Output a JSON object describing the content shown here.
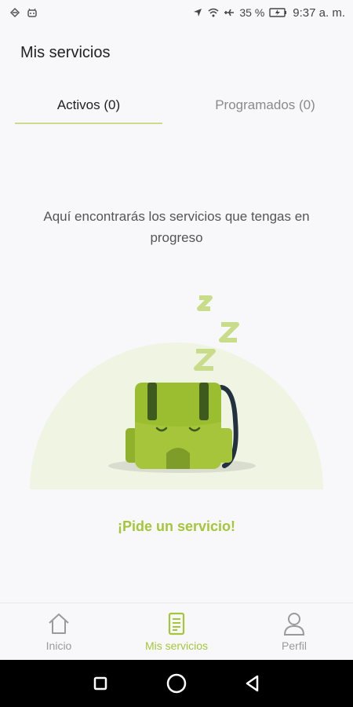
{
  "status_bar": {
    "battery": "35 %",
    "time": "9:37 a. m."
  },
  "page": {
    "title": "Mis servicios"
  },
  "tabs": [
    {
      "label": "Activos (0)",
      "active": true
    },
    {
      "label": "Programados (0)",
      "active": false
    }
  ],
  "empty_state": {
    "message": "Aquí encontrarás los servicios que tengas en progreso",
    "cta_label": "¡Pide un servicio!"
  },
  "bottom_nav": {
    "items": [
      {
        "label": "Inicio",
        "icon": "home-icon",
        "active": false
      },
      {
        "label": "Mis servicios",
        "icon": "document-list-icon",
        "active": true
      },
      {
        "label": "Perfil",
        "icon": "user-icon",
        "active": false
      }
    ]
  },
  "colors": {
    "accent": "#a5c63b",
    "tab_underline": "#cddc8c",
    "background": "#f8f8fa"
  }
}
